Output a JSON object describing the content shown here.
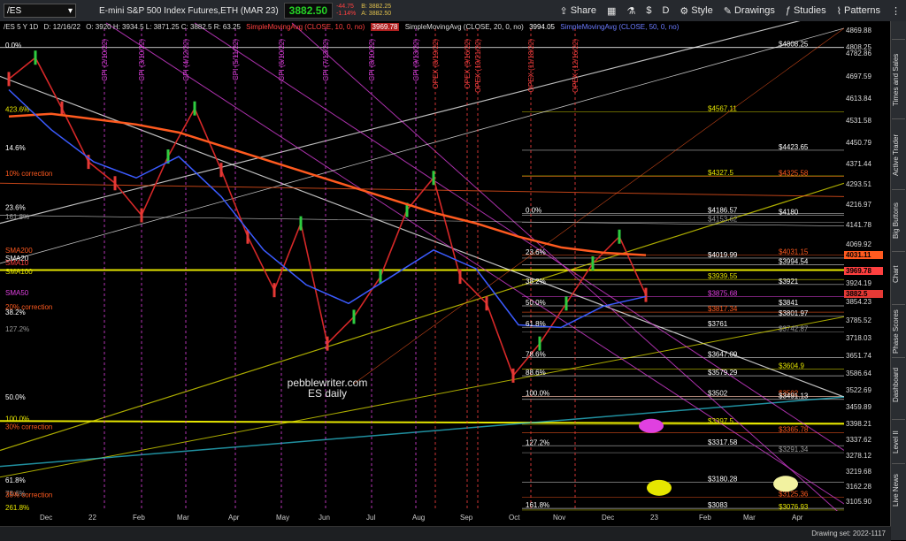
{
  "toolbar": {
    "symbol": "/ES",
    "title": "E-mini S&P 500 Index Futures,ETH (MAR 23)",
    "last_price": "3882.50",
    "change": "-44.75",
    "change_pct": "-1.14%",
    "bid": "B: 3882.25",
    "ask": "A: 3882.50",
    "buttons": [
      "Share",
      "D",
      "Style",
      "Drawings",
      "Studies",
      "Patterns"
    ]
  },
  "legend": {
    "symbol_info": "/ES 5 Y 1D",
    "date": "D: 12/16/22",
    "ohlc": "O: 3920   H: 3934.5   L: 3871.25   C: 3882.5   R: 63.25",
    "sma10": "SimpleMovingAvg (CLOSE, 10, 0, no)",
    "sma10_val": "3969.78",
    "sma20": "SimpleMovingAvg (CLOSE, 20, 0, no)",
    "sma20_val": "3994.05",
    "sma50": "SimpleMovingAvg (CLOSE, 50, 0, no)"
  },
  "right_tabs": [
    "Times and Sales",
    "Active Trader",
    "Big Buttons",
    "Chart",
    "Phase Scores",
    "Dashboard",
    "Level II",
    "Live News"
  ],
  "bottom": {
    "drawing_set": "Drawing set: 2022-1117"
  },
  "colors": {
    "bg": "#000000",
    "up": "#2ecc40",
    "down": "#e53935",
    "sma200": "#ff5a1f",
    "sma50": "#3b5bff",
    "magenta": "#e040e0",
    "yellow": "#e6e600",
    "cyan": "#2bc0d6"
  },
  "chart_data": {
    "type": "line",
    "title": "pebblewriter.com ES daily",
    "ylim": [
      3080,
      4880
    ],
    "y_ticks": [
      4869.88,
      4808.25,
      4782.86,
      4697.59,
      4613.84,
      4531.58,
      4450.79,
      4371.44,
      4293.51,
      4216.97,
      4141.78,
      4069.92,
      3924.19,
      3854.23,
      3785.52,
      3718.03,
      3651.74,
      3586.64,
      3522.69,
      3459.89,
      3398.21,
      3337.62,
      3278.12,
      3219.68,
      3162.28,
      3105.9
    ],
    "x_labels": [
      "Dec",
      "22",
      "Feb",
      "Mar",
      "Apr",
      "May",
      "Jun",
      "Jul",
      "Aug",
      "Sep",
      "Oct",
      "Nov",
      "Dec",
      "23",
      "Feb",
      "Mar",
      "Apr"
    ],
    "right_price_tags": [
      {
        "value": "4031.11",
        "color": "#ff5a1f"
      },
      {
        "value": "3969.78",
        "color": "#ff4040"
      },
      {
        "value": "3882.5",
        "color": "#e53935"
      }
    ],
    "level_labels": [
      {
        "text": "$4808.25",
        "value": 4808.25,
        "color": "#ffffff"
      },
      {
        "text": "$4567.11",
        "value": 4567.11,
        "color": "#e6e600"
      },
      {
        "text": "$4423.65",
        "value": 4423.65,
        "color": "#ffffff"
      },
      {
        "text": "$4327.5",
        "value": 4327.5,
        "color": "#e6e600"
      },
      {
        "text": "$4325.58",
        "value": 4325.58,
        "color": "#ff5a1f"
      },
      {
        "text": "$4186.57",
        "value": 4186.57,
        "color": "#ffffff"
      },
      {
        "text": "$4180",
        "value": 4180,
        "color": "#ffffff"
      },
      {
        "text": "$4153.62",
        "value": 4153.62,
        "color": "#999999"
      },
      {
        "text": "$4031.15",
        "value": 4031.15,
        "color": "#ff5a1f"
      },
      {
        "text": "$4019.99",
        "value": 4019.99,
        "color": "#ffffff"
      },
      {
        "text": "$3994.54",
        "value": 3994.54,
        "color": "#ffffff"
      },
      {
        "text": "$3939.55",
        "value": 3939.55,
        "color": "#e6e600"
      },
      {
        "text": "$3921",
        "value": 3921,
        "color": "#ffffff"
      },
      {
        "text": "$3875.68",
        "value": 3875.68,
        "color": "#e040e0"
      },
      {
        "text": "$3841",
        "value": 3841,
        "color": "#ffffff"
      },
      {
        "text": "$3817.34",
        "value": 3817.34,
        "color": "#ff5a1f"
      },
      {
        "text": "$3801.97",
        "value": 3801.97,
        "color": "#ffffff"
      },
      {
        "text": "$3761",
        "value": 3761,
        "color": "#ffffff"
      },
      {
        "text": "$3742.87",
        "value": 3742.87,
        "color": "#999999"
      },
      {
        "text": "$3647.09",
        "value": 3647.09,
        "color": "#ffffff"
      },
      {
        "text": "$3604.9",
        "value": 3604.9,
        "color": "#e6e600"
      },
      {
        "text": "$3579.29",
        "value": 3579.29,
        "color": "#ffffff"
      },
      {
        "text": "$3502",
        "value": 3502,
        "color": "#ff5a1f"
      },
      {
        "text": "$3502",
        "value": 3502,
        "color": "#ffffff"
      },
      {
        "text": "$3491.13",
        "value": 3491.13,
        "color": "#ffffff"
      },
      {
        "text": "$3397.5",
        "value": 3397.5,
        "color": "#e6e600"
      },
      {
        "text": "$3365.78",
        "value": 3365.78,
        "color": "#ff5a1f"
      },
      {
        "text": "$3317.58",
        "value": 3317.58,
        "color": "#ffffff"
      },
      {
        "text": "$3291.34",
        "value": 3291.34,
        "color": "#999999"
      },
      {
        "text": "$3180.28",
        "value": 3180.28,
        "color": "#ffffff"
      },
      {
        "text": "$3125.36",
        "value": 3125.36,
        "color": "#ff5a1f"
      },
      {
        "text": "$3083",
        "value": 3083,
        "color": "#ffffff"
      },
      {
        "text": "$3076.93",
        "value": 3076.93,
        "color": "#e6e600"
      }
    ],
    "fib_labels_left": [
      {
        "text": "0.0%",
        "value": 4808,
        "color": "#ffffff"
      },
      {
        "text": "423.6%",
        "value": 4567,
        "color": "#e6e600"
      },
      {
        "text": "14.6%",
        "value": 4424,
        "color": "#ffffff"
      },
      {
        "text": "10% correction",
        "value": 4327,
        "color": "#ff5a1f"
      },
      {
        "text": "23.6%",
        "value": 4200,
        "color": "#ffffff"
      },
      {
        "text": "161.8%",
        "value": 4165,
        "color": "#999999"
      },
      {
        "text": "SMA200",
        "value": 4040,
        "color": "#ff5a1f"
      },
      {
        "text": "SMA20",
        "value": 4010,
        "color": "#ffffff"
      },
      {
        "text": "SMA10",
        "value": 3994,
        "color": "#ff4040"
      },
      {
        "text": "SMA100",
        "value": 3960,
        "color": "#e6e600"
      },
      {
        "text": "SMA50",
        "value": 3880,
        "color": "#e040e0"
      },
      {
        "text": "20% correction",
        "value": 3828,
        "color": "#ff5a1f"
      },
      {
        "text": "38.2%",
        "value": 3808,
        "color": "#ffffff"
      },
      {
        "text": "127.2%",
        "value": 3745,
        "color": "#999999"
      },
      {
        "text": "50.0%",
        "value": 3491,
        "color": "#ffffff"
      },
      {
        "text": "100.0%",
        "value": 3410,
        "color": "#e6e600"
      },
      {
        "text": "30% correction",
        "value": 3380,
        "color": "#ff5a1f"
      },
      {
        "text": "61.8%",
        "value": 3180,
        "color": "#ffffff"
      },
      {
        "text": "78.6%",
        "value": 3130,
        "color": "#999999"
      },
      {
        "text": "35% correction",
        "value": 3125,
        "color": "#ff5a1f"
      },
      {
        "text": "261.8%",
        "value": 3077,
        "color": "#e6e600"
      }
    ],
    "fib_labels_mid": [
      {
        "text": "0.0%",
        "value": 4186,
        "color": "#ffffff"
      },
      {
        "text": "23.6%",
        "value": 4030,
        "color": "#ffffff"
      },
      {
        "text": "38.2%",
        "value": 3921,
        "color": "#ffffff"
      },
      {
        "text": "50.0%",
        "value": 3841,
        "color": "#ffffff"
      },
      {
        "text": "61.8%",
        "value": 3761,
        "color": "#ffffff"
      },
      {
        "text": "78.6%",
        "value": 3647,
        "color": "#ffffff"
      },
      {
        "text": "88.6%",
        "value": 3579,
        "color": "#ffffff"
      },
      {
        "text": "100.0%",
        "value": 3502,
        "color": "#ffffff"
      },
      {
        "text": "127.2%",
        "value": 3317,
        "color": "#ffffff"
      },
      {
        "text": "161.8%",
        "value": 3083,
        "color": "#ffffff"
      }
    ],
    "events": [
      "CPI (2/10/22)",
      "CPI (3/10/22)",
      "CPI (4/12/22)",
      "CPI (5/11/22)",
      "CPI (6/10/22)",
      "CPI (7/13/22)",
      "CPI (8/10/22)",
      "CPI (9/13/22)",
      "OPEX (8/19/22)",
      "OPEX (9/16/22)",
      "OPEX (10/21/22)",
      "OPEX (11/18/22)",
      "OPEX (12/16/22)"
    ],
    "price_series": [
      [
        "Dec",
        4690
      ],
      [
        "22",
        4770
      ],
      [
        "Jan",
        4580
      ],
      [
        "Feb",
        4380
      ],
      [
        "Feb2",
        4300
      ],
      [
        "Mar",
        4180
      ],
      [
        "Mar2",
        4400
      ],
      [
        "Apr",
        4580
      ],
      [
        "Apr2",
        4350
      ],
      [
        "May",
        4100
      ],
      [
        "May2",
        3900
      ],
      [
        "Jun",
        4150
      ],
      [
        "Jun2",
        3700
      ],
      [
        "Jul",
        3800
      ],
      [
        "Jul2",
        3950
      ],
      [
        "Aug",
        4200
      ],
      [
        "Aug2",
        4320
      ],
      [
        "Sep",
        3950
      ],
      [
        "Sep2",
        3850
      ],
      [
        "Oct",
        3580
      ],
      [
        "Oct2",
        3700
      ],
      [
        "Nov",
        3850
      ],
      [
        "Nov2",
        4000
      ],
      [
        "Dec2",
        4100
      ],
      [
        "Dec3",
        3882
      ]
    ],
    "sma200_series": [
      4550,
      4560,
      4540,
      4520,
      4490,
      4440,
      4390,
      4340,
      4290,
      4240,
      4190,
      4150,
      4100,
      4060,
      4040,
      4031
    ],
    "sma50_series": [
      4650,
      4500,
      4380,
      4320,
      4400,
      4250,
      4050,
      3920,
      3850,
      3950,
      4050,
      3980,
      3770,
      3760,
      3840,
      3876
    ]
  }
}
